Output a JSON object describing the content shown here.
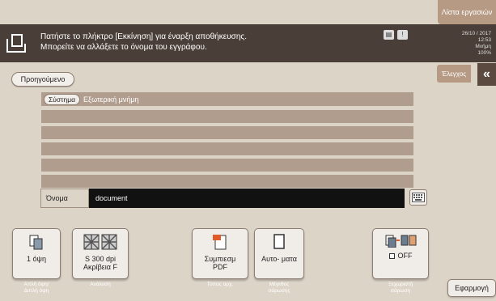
{
  "top_tab": {
    "label": "Λίστα εργασιών"
  },
  "message": {
    "line1": "Πατήστε το πλήκτρο [Εκκίνηση] για έναρξη αποθήκευσης.",
    "line2": "Μπορείτε να αλλάξετε το όνομα του εγγράφου."
  },
  "status_icons": [
    "status-scan-icon",
    "status-alert-icon"
  ],
  "info": {
    "date": "26/10 / 2017",
    "time": "12:53",
    "memory_label": "Μνήμη",
    "memory_value": "100%"
  },
  "check_tab": {
    "label": "Έλεγχος"
  },
  "back_button": {
    "label": "Προηγούμενο"
  },
  "path": {
    "chip": "Σύστημα",
    "text": "Εξωτερική μνήμη"
  },
  "name_field": {
    "label": "Όνομα",
    "value": "document"
  },
  "options": [
    {
      "value": "1 όψη",
      "caption": "Απλή όψη/\nΔιπλή όψη"
    },
    {
      "value": "S 300 dpi\nΑκρίβεια F",
      "caption": "Ανάλυση"
    },
    {
      "value": "Συμπιεσμ\nPDF",
      "caption": "Τύπος αρχ."
    },
    {
      "value": "Αυτο- ματα",
      "caption": "Μέγεθος\nσάρωσης"
    },
    {
      "value": "OFF",
      "caption": "Ξεχωριστή\nσάρωση"
    }
  ],
  "apply_button": {
    "label": "Εφαρμογή"
  },
  "colors": {
    "background": "#ddd4c8",
    "message_bar": "#4a3f38",
    "accent_tab": "#b79a84",
    "list_row": "#b09d8e"
  }
}
